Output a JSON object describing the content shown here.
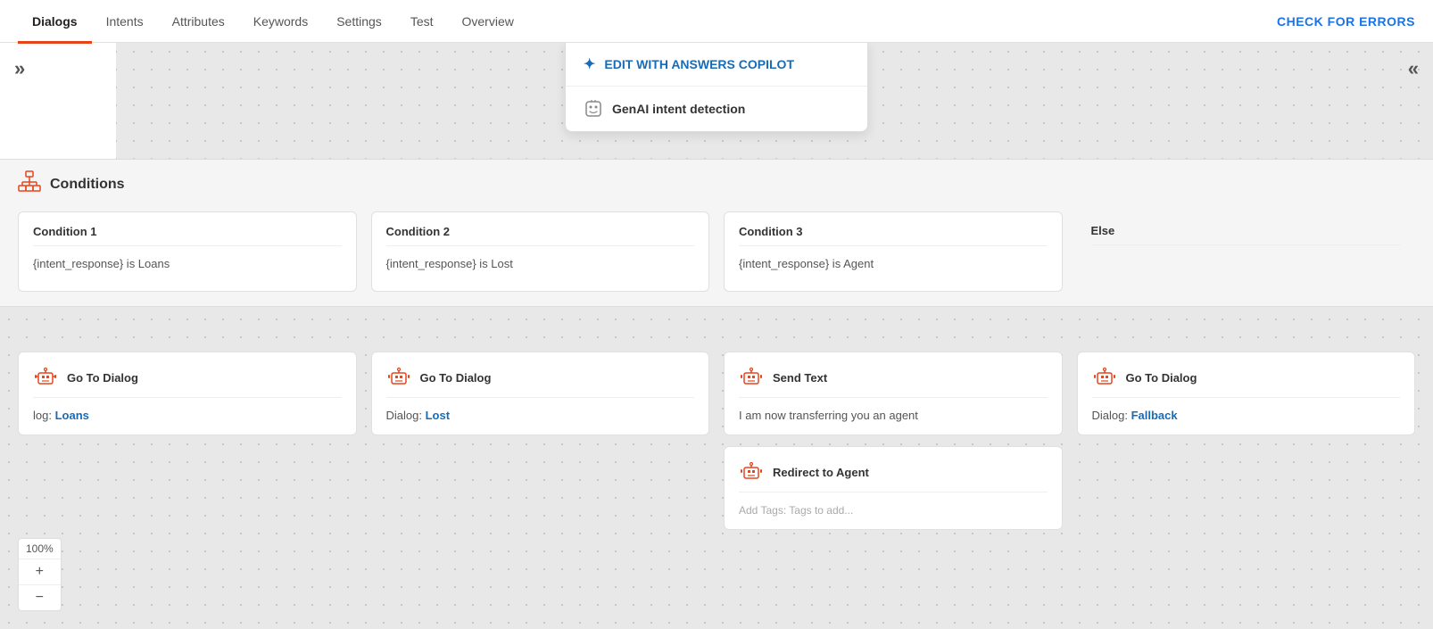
{
  "nav": {
    "tabs": [
      {
        "id": "dialogs",
        "label": "Dialogs",
        "active": true
      },
      {
        "id": "intents",
        "label": "Intents",
        "active": false
      },
      {
        "id": "attributes",
        "label": "Attributes",
        "active": false
      },
      {
        "id": "keywords",
        "label": "Keywords",
        "active": false
      },
      {
        "id": "settings",
        "label": "Settings",
        "active": false
      },
      {
        "id": "test",
        "label": "Test",
        "active": false
      },
      {
        "id": "overview",
        "label": "Overview",
        "active": false
      }
    ],
    "check_errors": "CHECK FOR ERRORS"
  },
  "dropdown": {
    "item1": "EDIT WITH ANSWERS COPILOT",
    "item2": "GenAI intent detection"
  },
  "left_toggle": "»",
  "right_toggle": "«",
  "conditions": {
    "title": "Conditions",
    "cards": [
      {
        "title": "Condition 1",
        "value": "{intent_response} is Loans"
      },
      {
        "title": "Condition 2",
        "value": "{intent_response} is Lost"
      },
      {
        "title": "Condition 3",
        "value": "{intent_response} is Agent"
      },
      {
        "title": "Else",
        "value": ""
      }
    ]
  },
  "actions": {
    "columns": [
      {
        "cards": [
          {
            "title": "Go To Dialog",
            "body_prefix": "log: ",
            "link_text": "Loans",
            "link": true
          }
        ]
      },
      {
        "cards": [
          {
            "title": "Go To Dialog",
            "body_prefix": "Dialog: ",
            "link_text": "Lost",
            "link": true
          }
        ]
      },
      {
        "cards": [
          {
            "title": "Send Text",
            "body_prefix": "",
            "link_text": "",
            "link": false,
            "body_text": "I am now transferring you an agent"
          },
          {
            "title": "Redirect to Agent",
            "body_prefix": "Add Tags: ",
            "link_text": "",
            "link": false,
            "body_text": "Add Tags: Tags to add..."
          }
        ]
      },
      {
        "cards": [
          {
            "title": "Go To Dialog",
            "body_prefix": "Dialog: ",
            "link_text": "Fallback",
            "link": true
          }
        ]
      }
    ]
  },
  "zoom": {
    "level": "100%",
    "plus": "+",
    "minus": "−"
  }
}
